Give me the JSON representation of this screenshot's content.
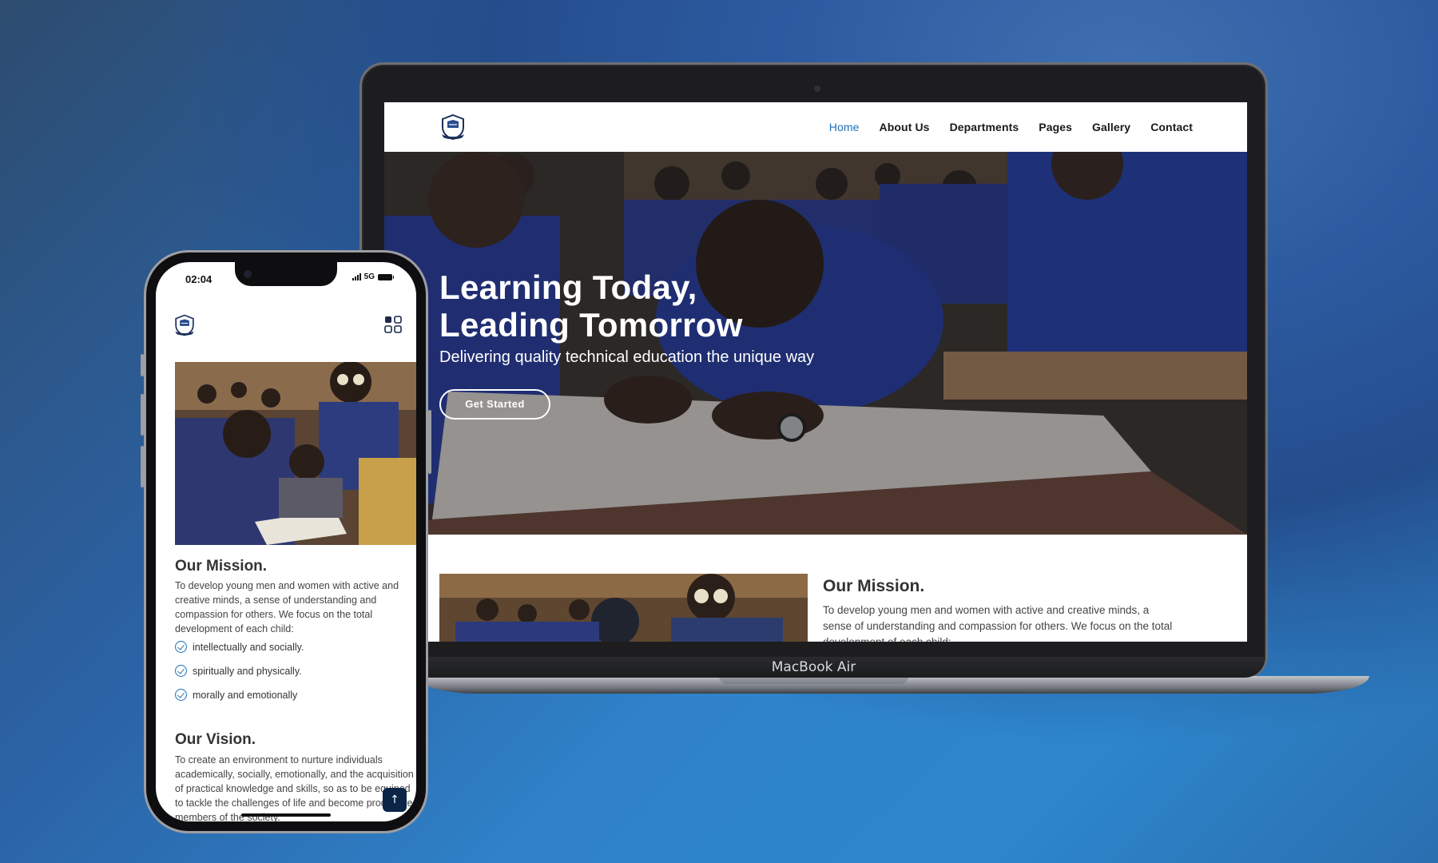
{
  "colors": {
    "accent": "#1e6fb8",
    "nav_text": "#1a1a1a",
    "scroll_top_bg": "#0b2547"
  },
  "laptop": {
    "brand_label": "MacBook Air",
    "nav": {
      "items": [
        {
          "label": "Home",
          "active": true
        },
        {
          "label": "About Us",
          "active": false
        },
        {
          "label": "Departments",
          "active": false
        },
        {
          "label": "Pages",
          "active": false
        },
        {
          "label": "Gallery",
          "active": false
        },
        {
          "label": "Contact",
          "active": false
        }
      ]
    },
    "hero": {
      "title_line1": "Learning Today,",
      "title_line2": "Leading Tomorrow",
      "subtitle": "Delivering quality technical education the unique way",
      "cta": "Get Started"
    },
    "mission": {
      "title": "Our Mission.",
      "text": "To develop young men and women with active and creative minds, a sense of understanding and compassion for others. We focus on the total development of each child:"
    }
  },
  "phone": {
    "status": {
      "time": "02:04",
      "network": "5G"
    },
    "mission": {
      "title": "Our Mission.",
      "text": "To develop young men and women with active and creative minds, a sense of understanding and compassion for others. We focus on the total development of each child:",
      "points": [
        "intellectually and socially.",
        "spiritually and physically.",
        "morally and emotionally"
      ]
    },
    "vision": {
      "title": "Our Vision.",
      "text": "To create an environment to nurture individuals academically, socially, emotionally, and the acquisition of practical knowledge and skills, so as to be equiped to tackle the challenges of life and become productive members of the society."
    },
    "scroll_top_icon": "arrow-up-icon",
    "menu_icon": "grid-menu-icon"
  }
}
